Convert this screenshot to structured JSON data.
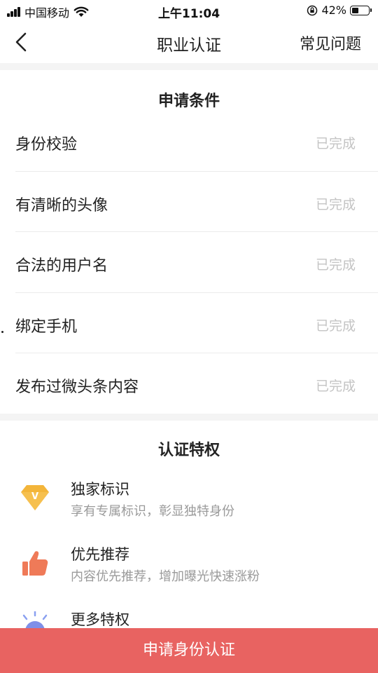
{
  "status_bar": {
    "carrier": "中国移动",
    "time": "上午11:04",
    "battery": "42%",
    "battery_level": 0.42
  },
  "nav": {
    "title": "职业认证",
    "faq": "常见问题",
    "back_icon": "chevron-left-icon"
  },
  "conditions": {
    "title": "申请条件",
    "items": [
      {
        "label": "身份校验",
        "status": "已完成"
      },
      {
        "label": "有清晰的头像",
        "status": "已完成"
      },
      {
        "label": "合法的用户名",
        "status": "已完成"
      },
      {
        "label": "绑定手机",
        "status": "已完成"
      },
      {
        "label": "发布过微头条内容",
        "status": "已完成"
      }
    ]
  },
  "privileges": {
    "title": "认证特权",
    "items": [
      {
        "title": "独家标识",
        "desc": "享有专属标识，彰显独特身份",
        "icon": "diamond-v-icon"
      },
      {
        "title": "优先推荐",
        "desc": "内容优先推荐，增加曝光快速涨粉",
        "icon": "thumbs-up-icon"
      },
      {
        "title": "更多特权",
        "desc": "",
        "icon": "bulb-icon"
      }
    ]
  },
  "apply_button": "申请身份认证",
  "colors": {
    "accent": "#e86361",
    "done_text": "#c4c4c4",
    "gold": "#f3b53a",
    "thumb": "#ef7a58"
  }
}
